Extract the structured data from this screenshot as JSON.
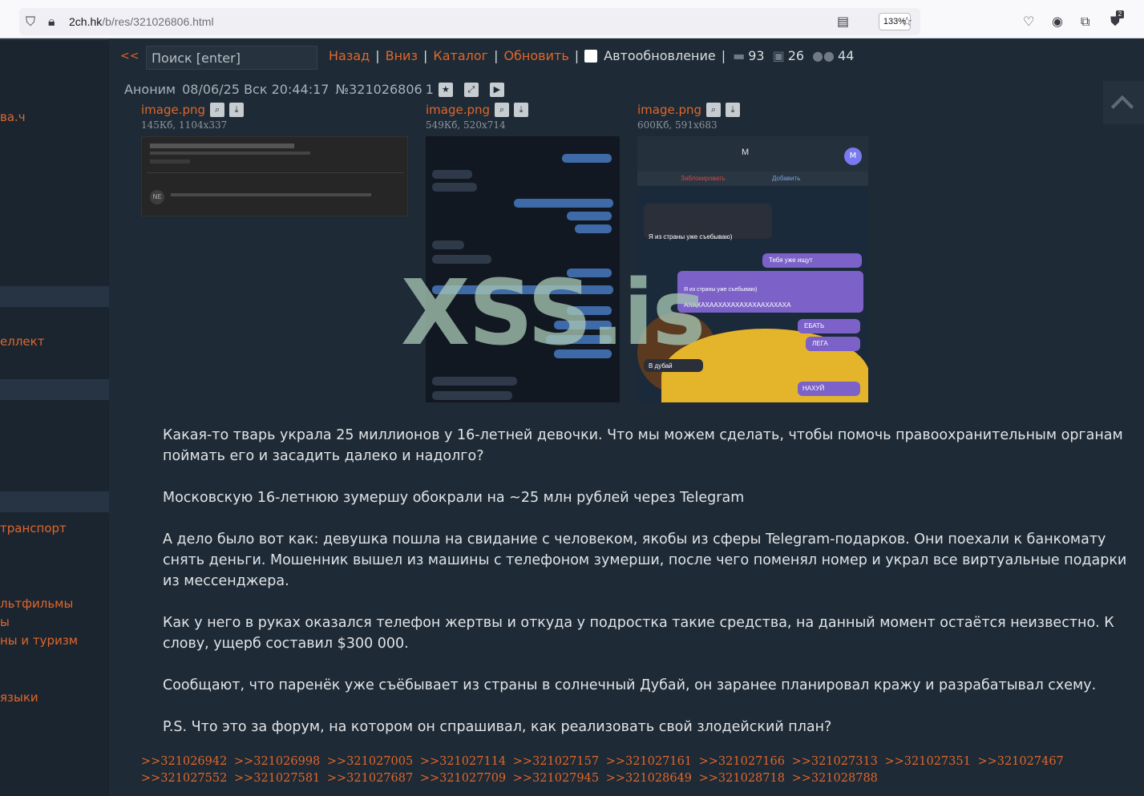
{
  "browser": {
    "url_host": "2ch.hk",
    "url_path": "/b/res/321026806.html",
    "zoom": "133%",
    "ext_badge": "2"
  },
  "sidebar": {
    "items": [
      "ва.ч",
      "еллект",
      "транспорт",
      "льтфильмы",
      "ы",
      "ны и туризм",
      "языки"
    ]
  },
  "nav": {
    "back": "<<",
    "search_placeholder": "Поиск [enter]",
    "links": [
      "Назад",
      "Вниз",
      "Каталог",
      "Обновить"
    ],
    "autoupdate": "Автообновление",
    "posts_count": "93",
    "images_count": "26",
    "users_count": "44"
  },
  "post": {
    "author": "Аноним",
    "date": "08/06/25 Вск 20:44:17",
    "number": "№321026806",
    "index": "1",
    "images": [
      {
        "name": "image.png",
        "meta": "145Кб, 1104x337"
      },
      {
        "name": "image.png",
        "meta": "549Кб, 520x714"
      },
      {
        "name": "image.png",
        "meta": "600Кб, 591x683"
      }
    ],
    "watermark": "XSS.is",
    "paragraphs": [
      "Какая-то тварь украла 25 миллионов у 16-летней девочки. Что мы можем сделать, чтобы помочь правоохранительным органам поймать его и засадить далеко и надолго?",
      "Московскую 16-летнюю зумершу обокрали на ~25 млн рублей через Telegram",
      "А дело было вот как: девушка пошла на свидание с человеком, якобы из сферы Telegram-подарков. Они поехали к банкомату снять деньги. Мошенник вышел из машины с телефоном зумерши, после чего поменял номер и украл все виртуальные подарки из мессенджера.",
      "Как у него в руках оказался телефон жертвы и откуда у подростка такие средства, на данный момент остаётся неизвестно. К слову, ущерб составил $300 000.",
      "Сообщают, что паренёк уже съёбывает из страны в солнечный Дубай, он заранее планировал кражу и разрабатывал схему.",
      "P.S. Что это за форум, на котором он спрашивал, как реализовать свой злодейский план?"
    ],
    "replies": [
      ">>321026942",
      ">>321026998",
      ">>321027005",
      ">>321027114",
      ">>321027157",
      ">>321027161",
      ">>321027166",
      ">>321027313",
      ">>321027351",
      ">>321027467",
      ">>321027552",
      ">>321027581",
      ">>321027687",
      ">>321027709",
      ">>321027945",
      ">>321028649",
      ">>321028718",
      ">>321028788"
    ]
  },
  "thumb1": {
    "avatar": "NE"
  },
  "thumb3": {
    "contact": "M",
    "avatar": "M",
    "block": "Заблокировать",
    "add": "Добавить",
    "m1": "Я из страны уже съебываю)",
    "m2": "Тебя уже ищут",
    "m3": "АХАХАХААХАХАХАХАХААХАХАХА",
    "m4": "ЕБАТЬ",
    "m5": "ЛЕГА",
    "m6": "В дубай",
    "m7": "НАХУЙ"
  },
  "colors": {
    "accent": "#e0662a",
    "background": "#1e2a35"
  }
}
